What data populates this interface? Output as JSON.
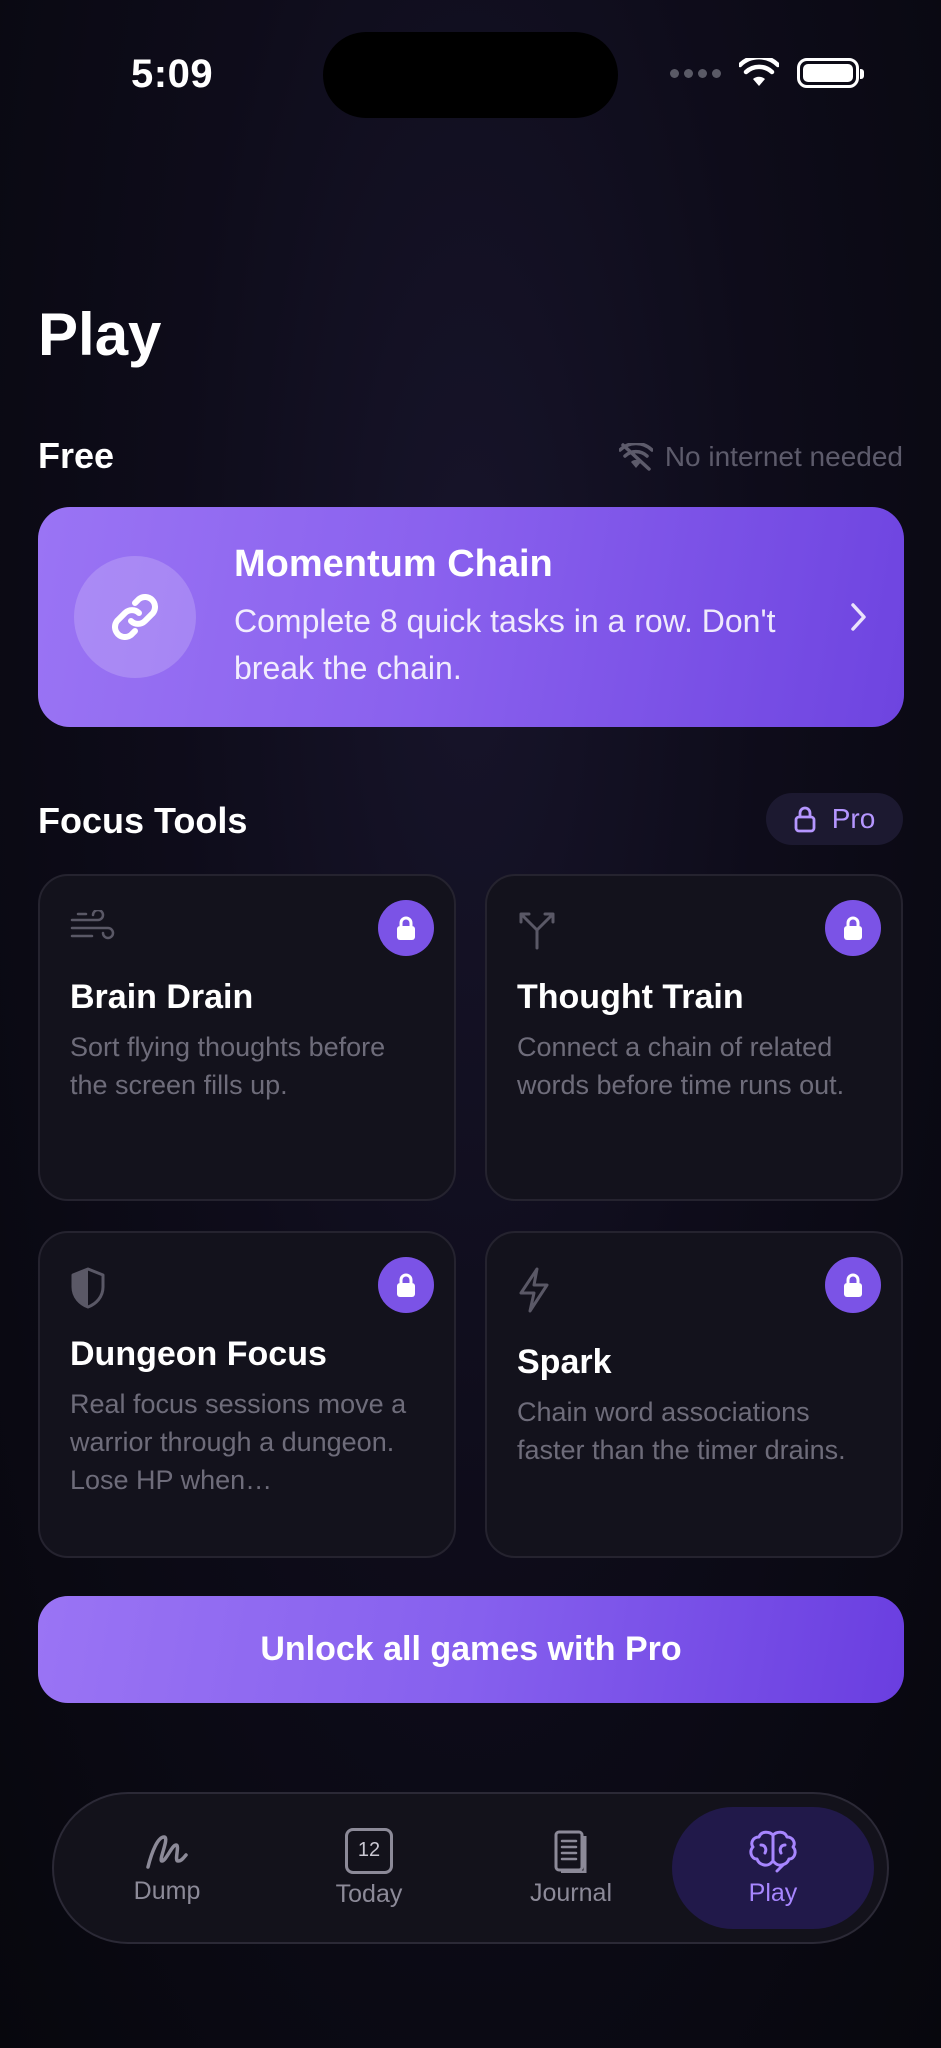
{
  "status_bar": {
    "time": "5:09"
  },
  "page": {
    "title": "Play"
  },
  "free": {
    "title": "Free",
    "offline_label": "No internet needed",
    "featured": {
      "title": "Momentum Chain",
      "description": "Complete 8 quick tasks in a row. Don't break the chain.",
      "icon": "link-icon"
    }
  },
  "focus_tools": {
    "title": "Focus Tools",
    "pro_label": "Pro",
    "games": [
      {
        "title": "Brain Drain",
        "description": "Sort flying thoughts before the screen fills up.",
        "icon": "wind-icon",
        "locked": true
      },
      {
        "title": "Thought Train",
        "description": "Connect a chain of related words before time runs out.",
        "icon": "merge-arrows-icon",
        "locked": true
      },
      {
        "title": "Dungeon Focus",
        "description": "Real focus sessions move a warrior through a dungeon. Lose HP when…",
        "icon": "shield-icon",
        "locked": true
      },
      {
        "title": "Spark",
        "description": "Chain word associations faster than the timer drains.",
        "icon": "bolt-icon",
        "locked": true
      }
    ]
  },
  "unlock_button": {
    "label": "Unlock all games with Pro"
  },
  "tabbar": {
    "tabs": [
      {
        "label": "Dump",
        "icon": "scribble-icon"
      },
      {
        "label": "Today",
        "icon": "calendar-icon",
        "badge": "12"
      },
      {
        "label": "Journal",
        "icon": "notebook-icon"
      },
      {
        "label": "Play",
        "icon": "brain-icon",
        "active": true
      }
    ]
  },
  "colors": {
    "accent": "#8a61ee",
    "accent_dark": "#6e44e0",
    "tab_active_bg": "#21194a",
    "tab_active_text": "#a786ff",
    "background": "#0e0c1a"
  }
}
